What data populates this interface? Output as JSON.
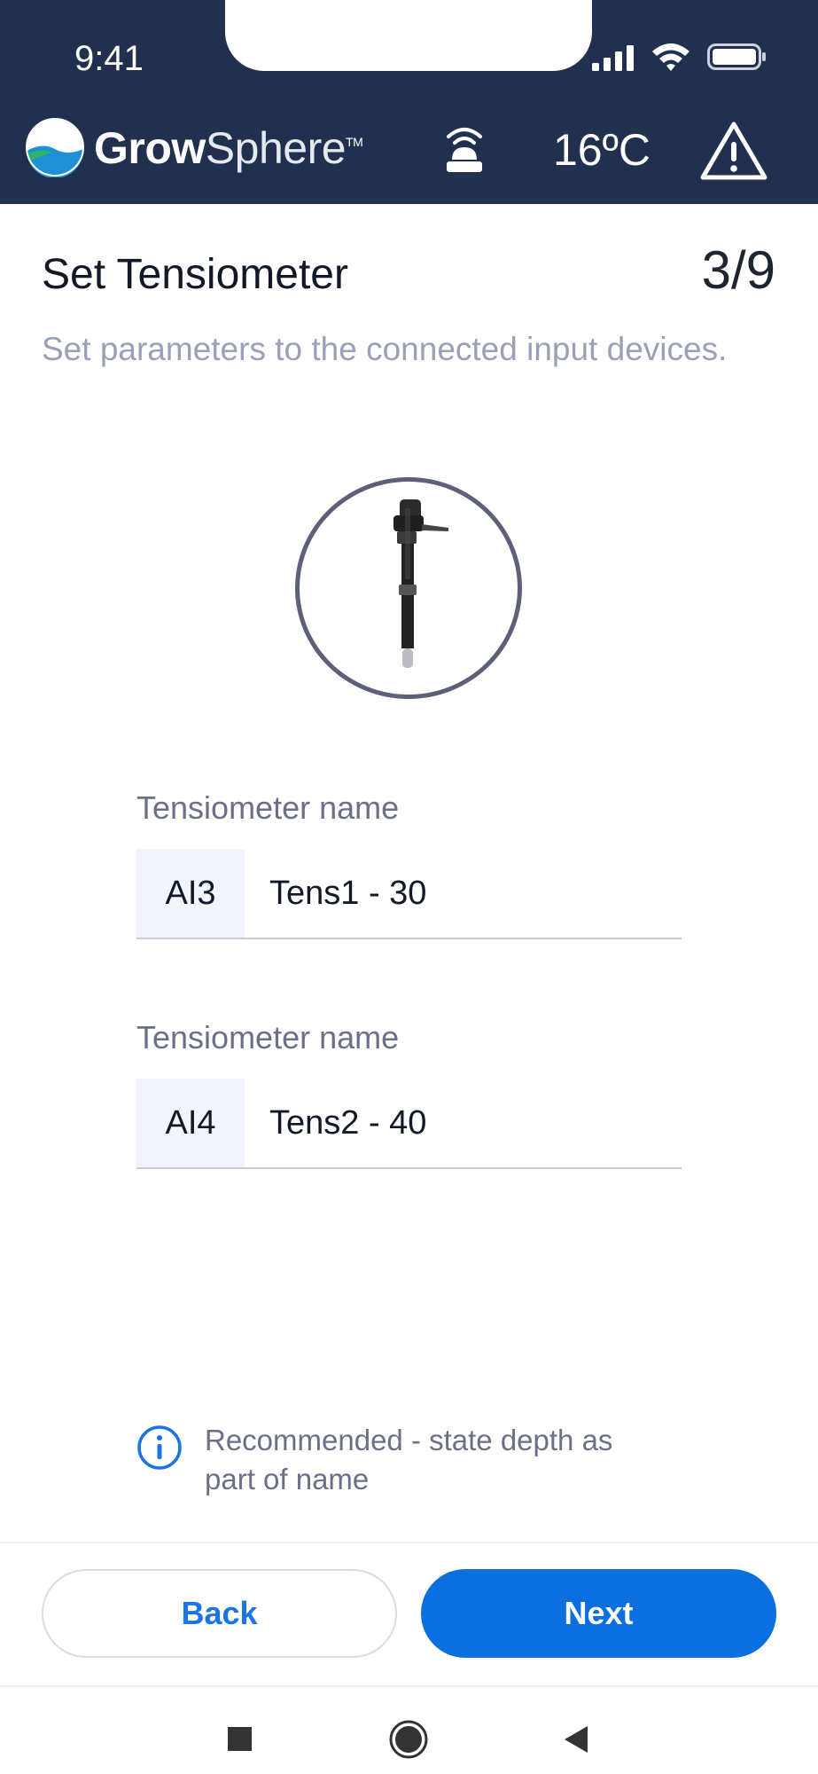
{
  "status_bar": {
    "time": "9:41",
    "icons": [
      "signal-icon",
      "wifi-icon",
      "battery-icon"
    ]
  },
  "header": {
    "brand_bold": "Grow",
    "brand_light": "Sphere",
    "brand_tm": "TM",
    "temperature": "16ºC",
    "icons": [
      "logo-icon",
      "beacon-icon",
      "warning-icon"
    ],
    "colors": {
      "background": "#22304f",
      "text": "#ffffff"
    }
  },
  "page": {
    "title": "Set Tensiometer",
    "step": "3/9",
    "subtitle": "Set parameters to the connected input devices."
  },
  "device": {
    "icon": "tensiometer-icon"
  },
  "fields": [
    {
      "label": "Tensiometer name",
      "prefix": "AI3",
      "value": "Tens1 - 30"
    },
    {
      "label": "Tensiometer name",
      "prefix": "AI4",
      "value": "Tens2 - 40"
    }
  ],
  "info": {
    "icon": "info-icon",
    "text": "Recommended - state depth as part of name"
  },
  "buttons": {
    "back": "Back",
    "next": "Next",
    "colors": {
      "primary": "#0b6fe0",
      "secondary_text": "#1a73e8"
    }
  },
  "nav": {
    "icons": [
      "square-icon",
      "home-icon",
      "back-triangle-icon"
    ]
  }
}
